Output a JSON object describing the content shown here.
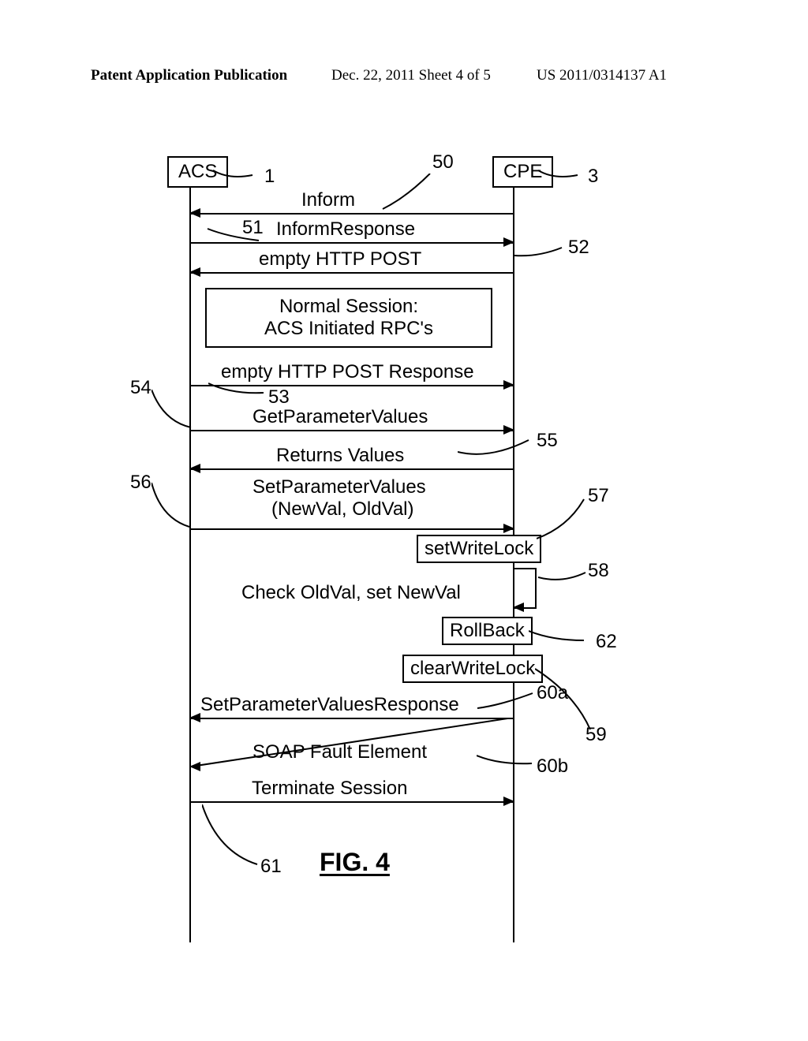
{
  "header": {
    "left": "Patent Application Publication",
    "mid": "Dec. 22, 2011  Sheet 4 of 5",
    "right": "US 2011/0314137 A1"
  },
  "actors": {
    "left": "ACS",
    "right": "CPE"
  },
  "numbers": {
    "acs": "1",
    "cpe": "3",
    "n50": "50",
    "n51": "51",
    "n52": "52",
    "n53": "53",
    "n54": "54",
    "n55": "55",
    "n56": "56",
    "n57": "57",
    "n58": "58",
    "n59": "59",
    "n60a": "60a",
    "n60b": "60b",
    "n61": "61",
    "n62": "62"
  },
  "messages": {
    "inform": "Inform",
    "informResponse": "InformResponse",
    "emptyPost": "empty HTTP POST",
    "normalSession1": "Normal Session:",
    "normalSession2": "ACS Initiated RPC's",
    "emptyPostResp": "empty HTTP POST Response",
    "getParamValues": "GetParameterValues",
    "returnsValues": "Returns Values",
    "setParamValues1": "SetParameterValues",
    "setParamValues2": "(NewVal, OldVal)",
    "setWriteLock": "setWriteLock",
    "checkOldVal": "Check OldVal, set NewVal",
    "rollback": "RollBack",
    "clearWriteLock": "clearWriteLock",
    "setParamResp": "SetParameterValuesResponse",
    "soapFault": "SOAP Fault Element",
    "terminate": "Terminate Session"
  },
  "figure": "FIG. 4"
}
